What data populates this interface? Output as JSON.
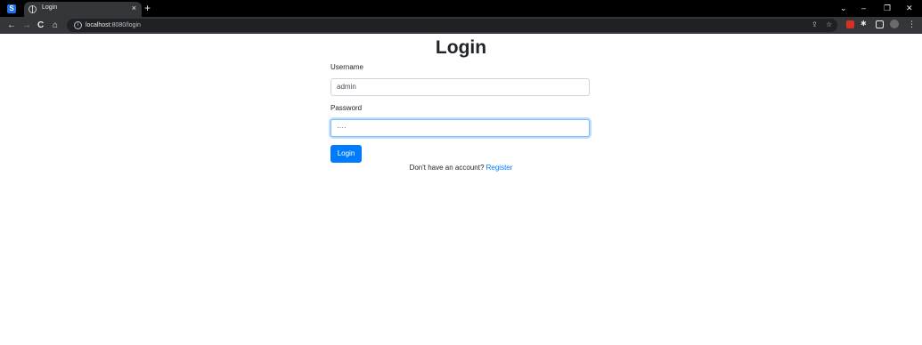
{
  "browser": {
    "app_badge": "S",
    "tab": {
      "title": "Login",
      "close": "×"
    },
    "new_tab": "+",
    "window_controls": {
      "dropdown": "⌄",
      "minimize": "–",
      "restore": "❐",
      "close": "✕"
    },
    "nav": {
      "back": "←",
      "forward": "→",
      "reload": "C",
      "home": "⌂"
    },
    "url": {
      "host": "localhost",
      "rest": ":8080/login"
    },
    "omnibox_icons": {
      "share": "⇪",
      "bookmark": "☆"
    },
    "extensions": {
      "puzzle": "✱",
      "menu": "⋮"
    }
  },
  "page": {
    "title": "Login",
    "username": {
      "label": "Username",
      "value": "admin"
    },
    "password": {
      "label": "Password",
      "value": "····"
    },
    "login_button": "Login",
    "register_prompt": "Don't have an account?",
    "register_link": "Register",
    "colors": {
      "primary": "#007bff",
      "text": "#212529",
      "focus_border": "#80bdff"
    }
  }
}
